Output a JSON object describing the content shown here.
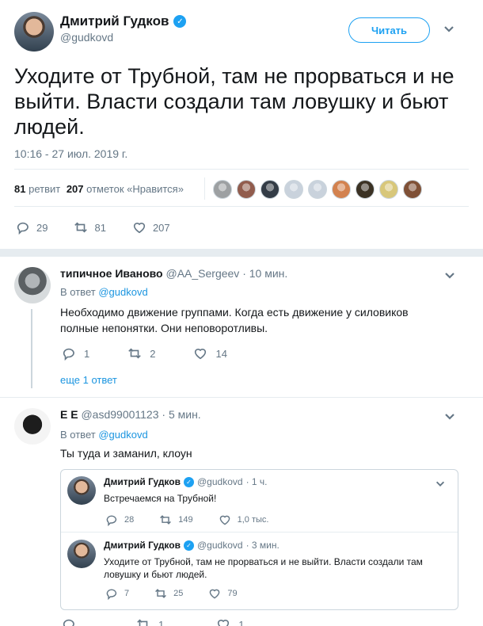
{
  "header": {
    "name": "Дмитрий Гудков",
    "handle": "@gudkovd",
    "follow_label": "Читать"
  },
  "tweet": {
    "text": "Уходите от Трубной, там не прорваться и не выйти. Власти создали там ловушку и бьют людей.",
    "timestamp": "10:16 - 27 июл. 2019 г.",
    "retweets_count": "81",
    "retweets_label": "ретвит",
    "likes_count": "207",
    "likes_label": "отметок «Нравится»",
    "actions": {
      "replies": "29",
      "retweets": "81",
      "likes": "207"
    },
    "liker_avatars": [
      "#9da0a2",
      "#915c4d",
      "#333c46",
      "#c9d2dc",
      "#c9d2dc",
      "#d3824f",
      "#3b3224",
      "#d8c77a",
      "#7f5137"
    ]
  },
  "replies": [
    {
      "name": "типичное Иваново",
      "handle": "@AA_Sergeev",
      "time": "· 10 мин.",
      "reply_to_label": "В ответ",
      "reply_to_handle": "@gudkovd",
      "text": "Необходимо движение группами. Когда есть движение у силовиков полные непонятки. Они неповоротливы.",
      "actions": {
        "replies": "1",
        "retweets": "2",
        "likes": "14"
      },
      "more_replies": "еще 1 ответ"
    },
    {
      "name": "E E",
      "handle": "@asd99001123",
      "time": "· 5 мин.",
      "reply_to_label": "В ответ",
      "reply_to_handle": "@gudkovd",
      "text": "Ты туда и заманил, клоун",
      "actions": {
        "replies": "",
        "retweets": "1",
        "likes": "1"
      }
    }
  ],
  "quoted": [
    {
      "name": "Дмитрий Гудков",
      "handle": "@gudkovd",
      "time": "· 1 ч.",
      "text": "Встречаемся на Трубной!",
      "actions": {
        "replies": "28",
        "retweets": "149",
        "likes": "1,0 тыс."
      }
    },
    {
      "name": "Дмитрий Гудков",
      "handle": "@gudkovd",
      "time": "· 3 мин.",
      "text": "Уходите от Трубной, там не прорваться и не выйти. Власти создали там ловушку и бьют людей.",
      "actions": {
        "replies": "7",
        "retweets": "25",
        "likes": "79"
      }
    }
  ]
}
